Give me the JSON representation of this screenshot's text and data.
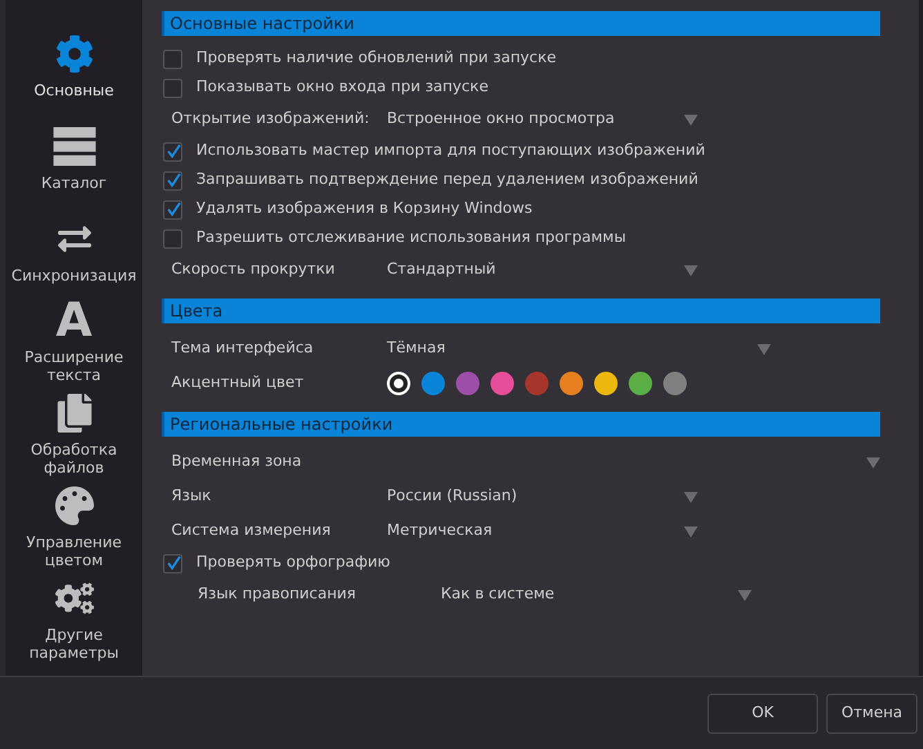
{
  "sidebar": {
    "items": [
      {
        "kind": "gear",
        "label": "Основные",
        "selected": true
      },
      {
        "kind": "catalog",
        "label": "Каталог",
        "selected": false
      },
      {
        "kind": "sync",
        "label": "Синхронизация",
        "selected": false
      },
      {
        "kind": "glyph",
        "glyph": "A",
        "label": "Расширение текста",
        "selected": false
      },
      {
        "kind": "files",
        "label": "Обработка файлов",
        "selected": false
      },
      {
        "kind": "palette",
        "label": "Управление цветом",
        "selected": false
      },
      {
        "kind": "gears",
        "label": "Другие параметры",
        "selected": false
      }
    ]
  },
  "sections": [
    {
      "title": "Основные настройки",
      "rows": [
        {
          "kind": "checkbox",
          "label": "Проверять наличие обновлений при запуске",
          "checked": false
        },
        {
          "kind": "checkbox",
          "label": "Показывать окно входа при запуске",
          "checked": false
        },
        {
          "kind": "select",
          "label": "Открытие изображений:",
          "value": "Встроенное окно просмотра"
        },
        {
          "kind": "checkbox",
          "label": "Использовать мастер импорта для поступающих изображений",
          "checked": true
        },
        {
          "kind": "checkbox",
          "label": "Запрашивать подтверждение перед удалением изображений",
          "checked": true
        },
        {
          "kind": "checkbox",
          "label": "Удалять изображения в Корзину Windows",
          "checked": true
        },
        {
          "kind": "checkbox",
          "label": "Разрешить отслеживание использования программы",
          "checked": false
        },
        {
          "kind": "select",
          "label": "Скорость прокрутки",
          "value": "Стандартный"
        }
      ]
    },
    {
      "title": "Цвета",
      "rows": [
        {
          "kind": "wide-select",
          "label": "Тема интерфейса",
          "value": "Тёмная"
        },
        {
          "kind": "swatches",
          "label": "Акцентный цвет",
          "colors": [
            {
              "color": "#ffffff",
              "selected": true
            },
            {
              "color": "#0a84d8",
              "selected": false
            },
            {
              "color": "#9b4fa6",
              "selected": false
            },
            {
              "color": "#e74e9a",
              "selected": false
            },
            {
              "color": "#a6352c",
              "selected": false
            },
            {
              "color": "#e57f1f",
              "selected": false
            },
            {
              "color": "#ecb70e",
              "selected": false
            },
            {
              "color": "#5aae45",
              "selected": false
            },
            {
              "color": "#808080",
              "selected": false
            }
          ]
        }
      ]
    },
    {
      "title": "Региональные настройки",
      "rows": [
        {
          "kind": "wide-select",
          "label": "Временная зона"
        },
        {
          "kind": "select",
          "label": "Язык",
          "value": "России (Russian)"
        },
        {
          "kind": "select",
          "label": "Система измерения",
          "value": "Метрическая"
        },
        {
          "kind": "checkbox",
          "label": "Проверять орфографию",
          "checked": true,
          "children": [
            {
              "kind": "select",
              "label": "Язык правописания",
              "value": "Как в системе"
            }
          ]
        }
      ]
    }
  ],
  "buttons": [
    "OK",
    "Отмена"
  ]
}
